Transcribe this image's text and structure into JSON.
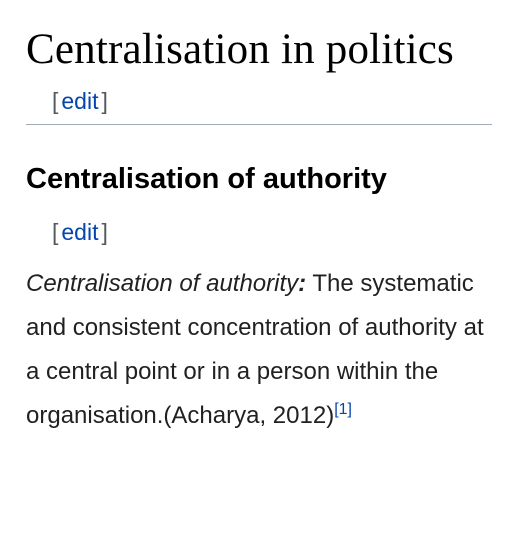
{
  "section": {
    "title": "Centralisation in politics",
    "edit_open": "[",
    "edit_label": "edit",
    "edit_close": "]"
  },
  "subsection": {
    "title": "Centralisation of authority",
    "edit_open": "[",
    "edit_label": "edit",
    "edit_close": "]"
  },
  "paragraph": {
    "term": "Centralisation of authority",
    "colon": ":",
    "text": " The systematic and consistent concentration of authority at a central point or in a person within the organisation.(Acharya, 2012)",
    "citation": "[1]"
  }
}
